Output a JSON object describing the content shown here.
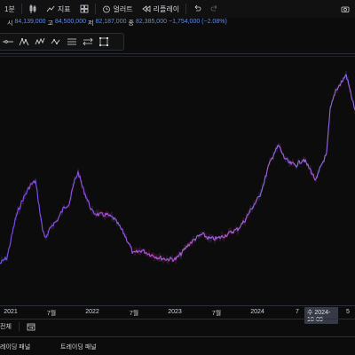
{
  "toolbar": {
    "interval": "1분",
    "indicators_label": "지표",
    "alert_label": "얼러트",
    "replay_label": "리플레이"
  },
  "ohlc": {
    "o_label": "시",
    "o_value": "84,139,000",
    "h_label": "고",
    "h_value": "84,500,000",
    "l_label": "저",
    "l_value": "82,187,000",
    "c_label": "종",
    "c_value": "82,385,000",
    "change": "−1,754,000 (−2.08%)"
  },
  "xaxis": {
    "ticks": [
      "2021",
      "7월",
      "2022",
      "7월",
      "2023",
      "7월",
      "2024",
      "7"
    ],
    "crosshair_label": "수 2024-10-09",
    "tail": "5"
  },
  "rangebar": {
    "all_label": "전체"
  },
  "bottom_tabs": {
    "tab1": "레이딩 패널",
    "tab2": "트레이딩 패널"
  },
  "colors": {
    "line_start": "#2962ff",
    "line_end": "#e040fb",
    "accent_blue": "#5b8bf7"
  }
}
